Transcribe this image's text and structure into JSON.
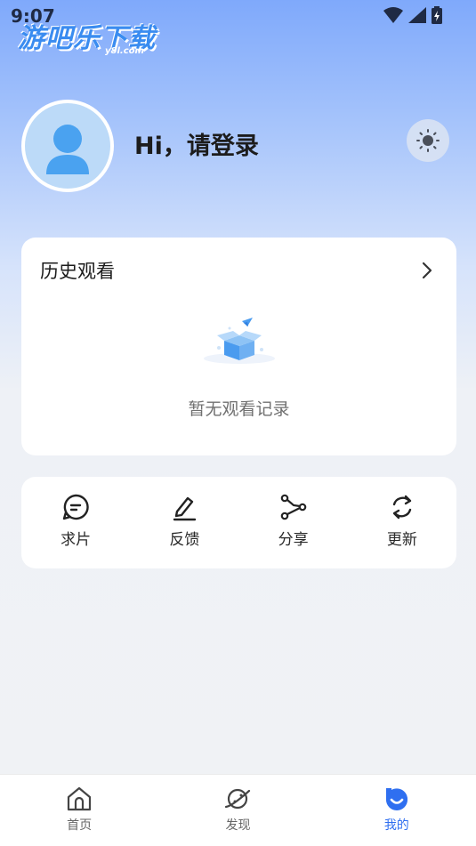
{
  "status_bar": {
    "time": "9:07"
  },
  "watermark": {
    "text": "游吧乐下载",
    "sub": "y8l.com"
  },
  "profile": {
    "greeting": "Hi，请登录"
  },
  "history": {
    "title": "历史观看",
    "empty_text": "暂无观看记录"
  },
  "tools": [
    {
      "label": "求片",
      "icon": "chat-bubble-icon"
    },
    {
      "label": "反馈",
      "icon": "pencil-icon"
    },
    {
      "label": "分享",
      "icon": "share-icon"
    },
    {
      "label": "更新",
      "icon": "refresh-icon"
    }
  ],
  "nav": {
    "items": [
      {
        "label": "首页",
        "icon": "home-icon"
      },
      {
        "label": "发现",
        "icon": "planet-icon"
      },
      {
        "label": "我的",
        "icon": "profile-face-icon"
      }
    ],
    "active_index": 2,
    "active_color": "#2f6ff0"
  }
}
